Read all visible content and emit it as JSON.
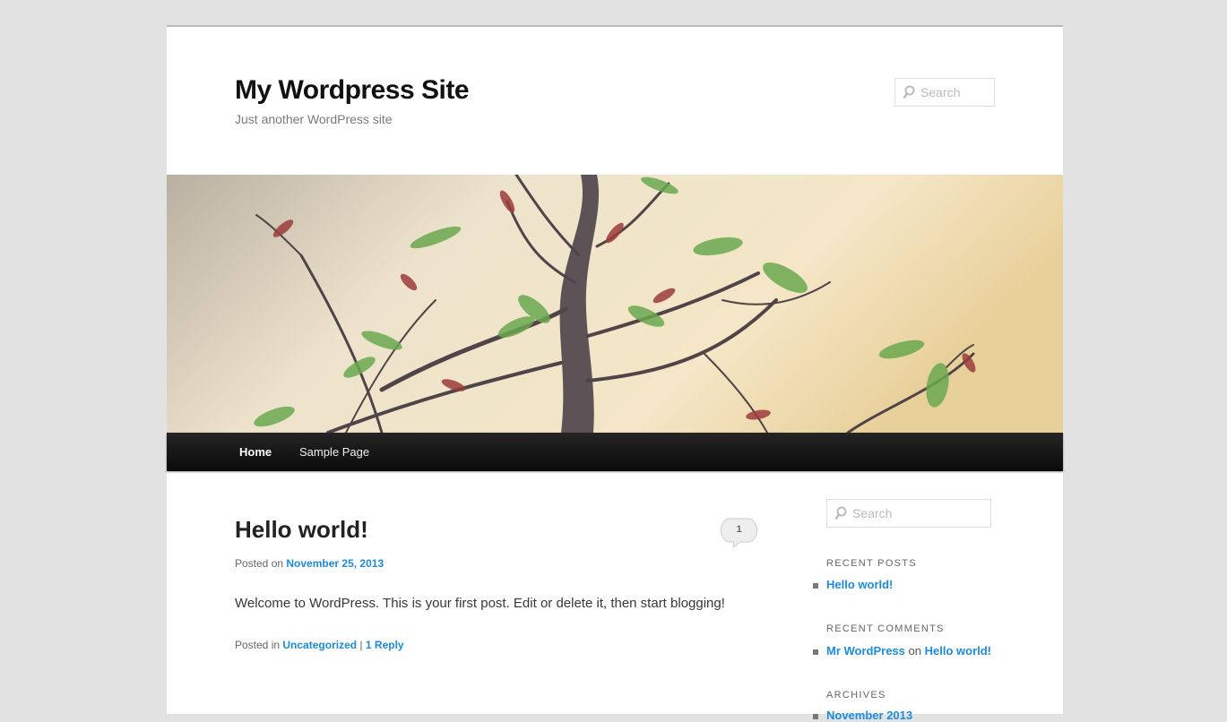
{
  "site": {
    "title": "My Wordpress Site",
    "description": "Just another WordPress site"
  },
  "header_search": {
    "placeholder": "Search"
  },
  "nav": {
    "items": [
      {
        "label": "Home",
        "current": true
      },
      {
        "label": "Sample Page",
        "current": false
      }
    ]
  },
  "post": {
    "title": "Hello world!",
    "comment_count": "1",
    "posted_on_prefix": "Posted on",
    "date": "November 25, 2013",
    "content": "Welcome to WordPress. This is your first post. Edit or delete it, then start blogging!",
    "posted_in_prefix": "Posted in",
    "category": "Uncategorized",
    "separator": "|",
    "reply_link": "1 Reply"
  },
  "sidebar": {
    "search_placeholder": "Search",
    "recent_posts": {
      "title": "Recent Posts",
      "items": [
        "Hello world!"
      ]
    },
    "recent_comments": {
      "title": "Recent Comments",
      "author": "Mr WordPress",
      "connector": "on",
      "post": "Hello world!"
    },
    "archives": {
      "title": "Archives",
      "items": [
        "November 2013"
      ]
    }
  },
  "colors": {
    "page_bg": "#e2e2e2",
    "link": "#1b8be0",
    "nav_bg": "#111111"
  }
}
